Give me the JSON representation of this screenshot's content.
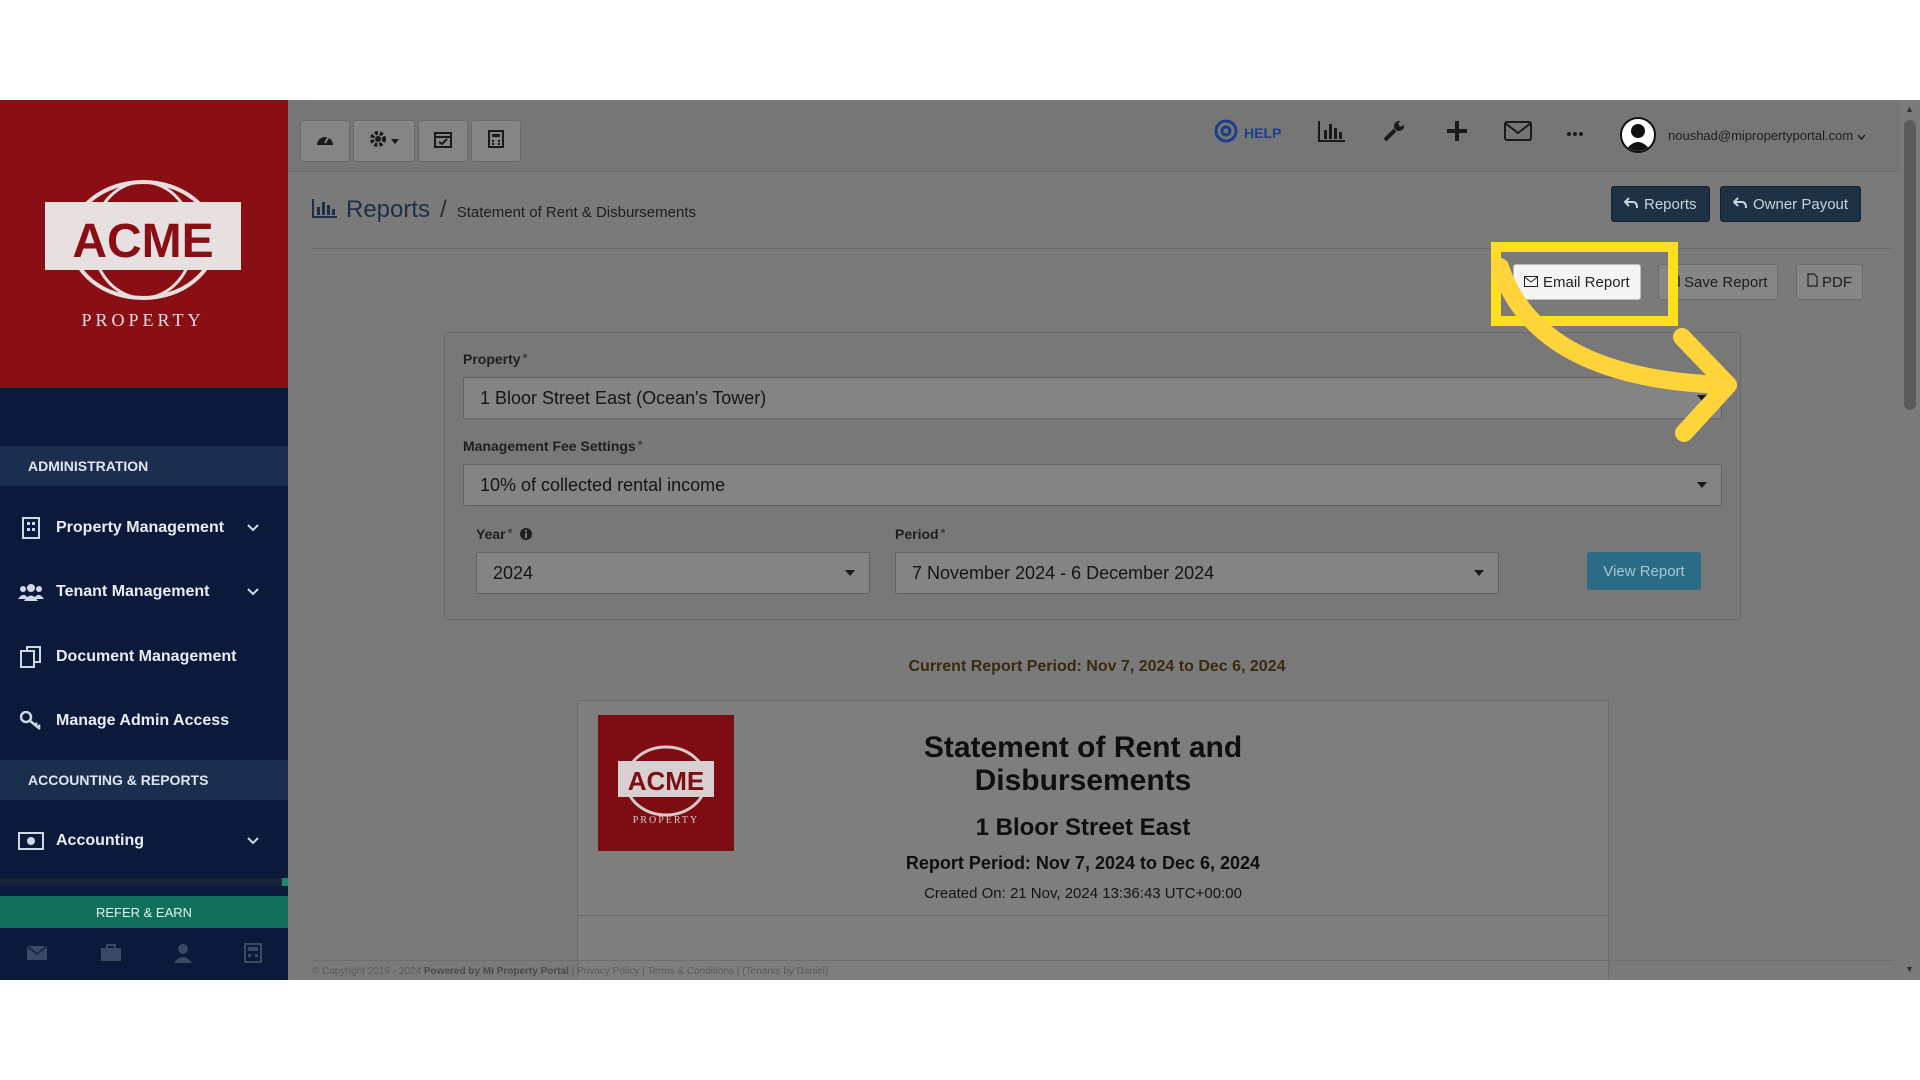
{
  "sidebar": {
    "brand": "ACME",
    "brand_sub": "PROPERTY",
    "sections": [
      {
        "title": "ADMINISTRATION"
      },
      {
        "title": "ACCOUNTING & REPORTS"
      }
    ],
    "items": [
      {
        "label": "Property Management",
        "icon": "building-icon"
      },
      {
        "label": "Tenant Management",
        "icon": "users-icon"
      },
      {
        "label": "Document Management",
        "icon": "documents-icon"
      },
      {
        "label": "Manage Admin Access",
        "icon": "key-icon"
      },
      {
        "label": "Accounting",
        "icon": "money-icon"
      }
    ],
    "refer": "REFER & EARN"
  },
  "topbar": {
    "help": "HELP",
    "user_email": "noushad@mipropertyportal.com"
  },
  "breadcrumb": {
    "title": "Reports",
    "separator": "/",
    "current": "Statement of Rent & Disbursements"
  },
  "actions": {
    "reports": "Reports",
    "owner_payout": "Owner Payout",
    "email_report": "Email Report",
    "save_report": "Save Report",
    "pdf": "PDF"
  },
  "form": {
    "property_label": "Property",
    "property_value": "1 Bloor Street East (Ocean's Tower)",
    "fee_label": "Management Fee Settings",
    "fee_value": "10% of collected rental income",
    "year_label": "Year",
    "year_value": "2024",
    "period_label": "Period",
    "period_value": "7 November 2024 - 6 December 2024",
    "required_mark": "*",
    "view_button": "View Report"
  },
  "current_period": "Current Report Period: Nov 7, 2024 to Dec 6, 2024",
  "report": {
    "title_line1": "Statement of Rent and",
    "title_line2": "Disbursements",
    "property": "1 Bloor Street East",
    "period": "Report Period: Nov 7, 2024 to Dec 6, 2024",
    "created": "Created On: 21 Nov, 2024 13:36:43 UTC+00:00",
    "logo_text": "ACME",
    "logo_sub": "PROPERTY"
  },
  "footer": {
    "copyright": "© Copyright 2016 - 2024",
    "powered": "Powered by MI Property Portal",
    "privacy": "Privacy Policy",
    "terms": "Terms & Conditions",
    "tenants": "(Tenants by Daniel)"
  },
  "colors": {
    "highlight": "#ffdf1f",
    "arrow": "#ffd43b",
    "sidebar": "#0b1a3a",
    "brand_red": "#8a0f15"
  }
}
